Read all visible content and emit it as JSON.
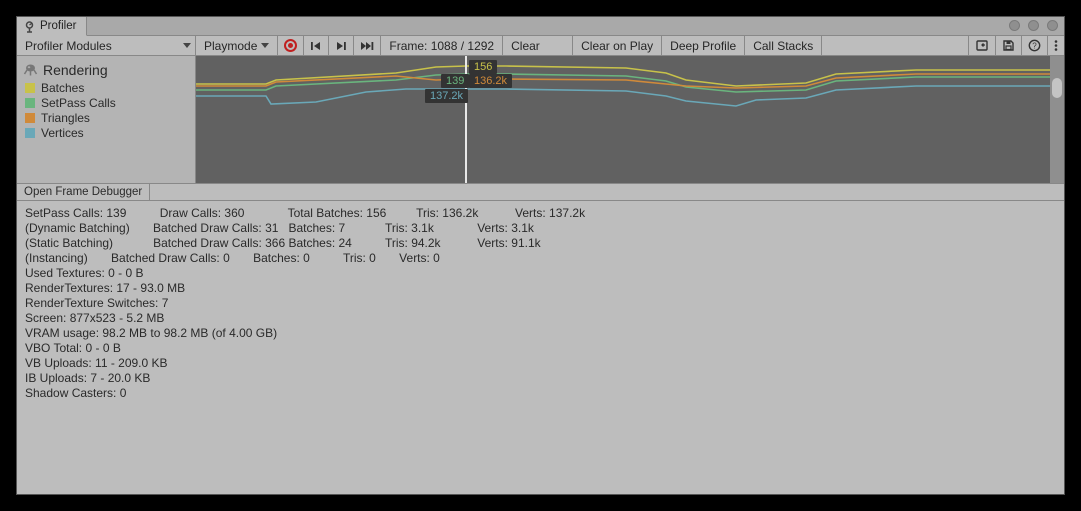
{
  "tab_title": "Profiler",
  "toolbar": {
    "profiler_modules": "Profiler Modules",
    "playmode": "Playmode",
    "frame_label": "Frame: 1088 / 1292",
    "clear": "Clear",
    "clear_on_play": "Clear on Play",
    "deep_profile": "Deep Profile",
    "call_stacks": "Call Stacks"
  },
  "category": {
    "title": "Rendering",
    "items": [
      {
        "label": "Batches",
        "color": "#c8c24a"
      },
      {
        "label": "SetPass Calls",
        "color": "#6ab57e"
      },
      {
        "label": "Triangles",
        "color": "#d08a3a"
      },
      {
        "label": "Vertices",
        "color": "#6aa8b8"
      }
    ]
  },
  "tips": {
    "batches": "156",
    "triangles": "136.2k",
    "setpass": "139",
    "vertices": "137.2k"
  },
  "open_frame_debugger": "Open Frame Debugger",
  "stats": {
    "row1": {
      "setpass": "SetPass Calls: 139",
      "drawcalls": "Draw Calls: 360",
      "total_batches": "Total Batches: 156",
      "tris": "Tris: 136.2k",
      "verts": "Verts: 137.2k"
    },
    "row2": {
      "label": "(Dynamic Batching)",
      "bdc": "Batched Draw Calls: 31",
      "batches": "Batches: 7",
      "tris": "Tris: 3.1k",
      "verts": "Verts: 3.1k"
    },
    "row3": {
      "label": "(Static Batching)",
      "bdc": "Batched Draw Calls: 366",
      "batches": "Batches: 24",
      "tris": "Tris: 94.2k",
      "verts": "Verts: 91.1k"
    },
    "row4": {
      "label": "(Instancing)",
      "bdc": "Batched Draw Calls: 0",
      "batches": "Batches: 0",
      "tris": "Tris: 0",
      "verts": "Verts: 0"
    },
    "used_textures": "Used Textures: 0 - 0 B",
    "rendertextures": "RenderTextures: 17 - 93.0 MB",
    "rt_switches": "RenderTexture Switches: 7",
    "screen": "Screen: 877x523 - 5.2 MB",
    "vram": "VRAM usage: 98.2 MB to 98.2 MB (of 4.00 GB)",
    "vbo_total": "VBO Total: 0 - 0 B",
    "vb_uploads": "VB Uploads: 11 - 209.0 KB",
    "ib_uploads": "IB Uploads: 7 - 20.0 KB",
    "shadow_casters": "Shadow Casters: 0"
  },
  "chart_data": {
    "type": "line",
    "title": "Rendering",
    "cursor_frame": 1088,
    "total_frames": 1292,
    "series": [
      {
        "name": "Batches",
        "value_at_cursor": 156,
        "ylim": [
          0,
          200
        ]
      },
      {
        "name": "SetPass Calls",
        "value_at_cursor": 139,
        "ylim": [
          0,
          200
        ]
      },
      {
        "name": "Triangles",
        "value_at_cursor": 136200,
        "ylim": [
          0,
          200000
        ]
      },
      {
        "name": "Vertices",
        "value_at_cursor": 137200,
        "ylim": [
          0,
          200000
        ]
      }
    ]
  }
}
